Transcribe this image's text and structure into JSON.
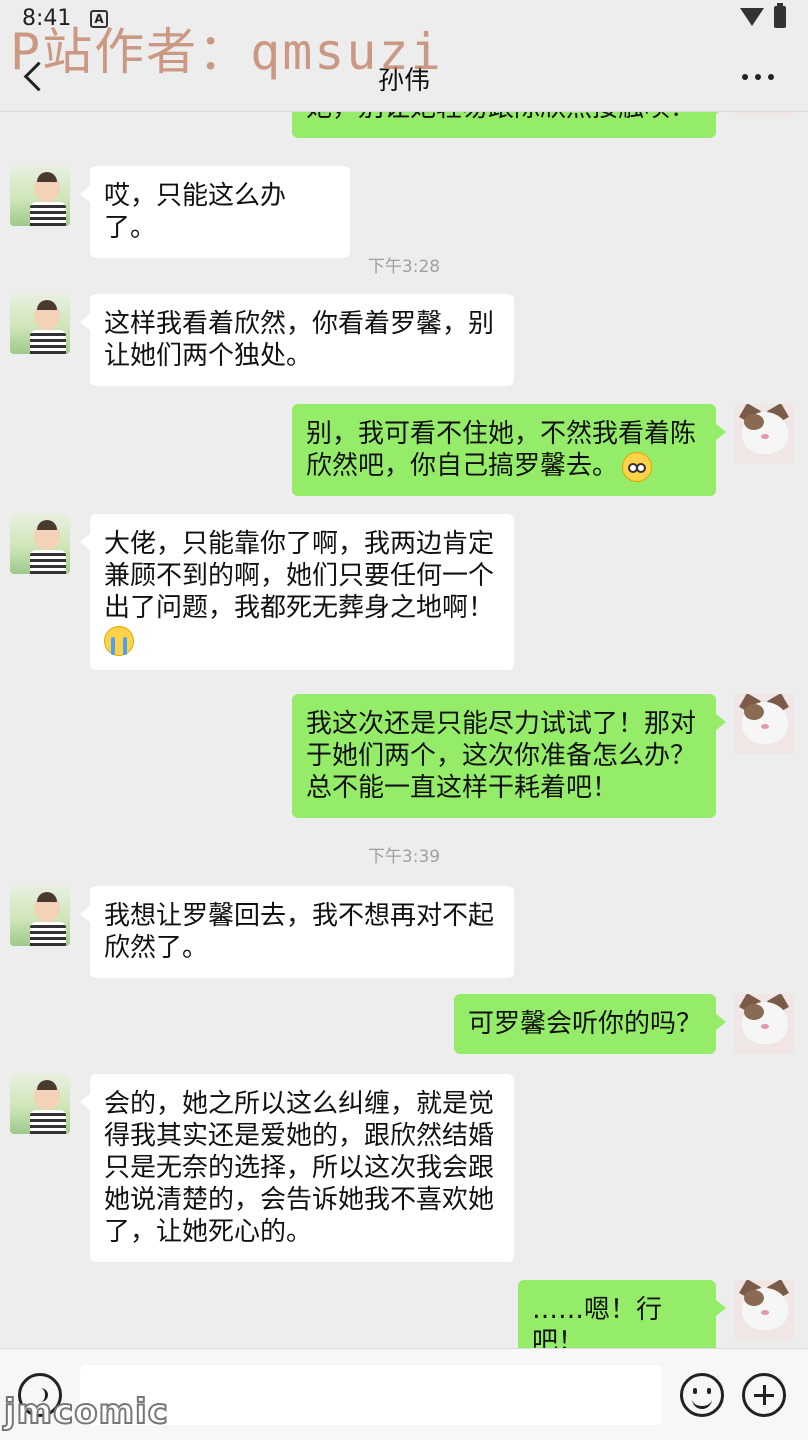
{
  "status_bar": {
    "time": "8:41",
    "notification_icon": "A"
  },
  "watermark": "P站作者：qmsuzi",
  "header": {
    "title": "孙伟"
  },
  "messages": [
    {
      "side": "out",
      "text": "她，别让她轻易跟陈欣然接触呗？"
    },
    {
      "side": "in",
      "text": "哎，只能这么办了。"
    },
    {
      "time": "下午3:28"
    },
    {
      "side": "in",
      "text": "这样我看着欣然，你看着罗馨，别\n让她们两个独处。"
    },
    {
      "side": "out",
      "text": "别，我可看不住她，不然我看着陈\n欣然吧，你自己搞罗馨去。",
      "emoji": "flushed-face-icon"
    },
    {
      "side": "in",
      "text": "大佬，只能靠你了啊，我两边肯定\n兼顾不到的啊，她们只要任何一个\n出了问题，我都死无葬身之地啊！",
      "emoji": "loudly-crying-face-icon"
    },
    {
      "side": "out",
      "text": "我这次还是只能尽力试试了！那对\n于她们两个，这次你准备怎么办？\n总不能一直这样干耗着吧！"
    },
    {
      "time": "下午3:39"
    },
    {
      "side": "in",
      "text": "我想让罗馨回去，我不想再对不起\n欣然了。"
    },
    {
      "side": "out",
      "text": "可罗馨会听你的吗？"
    },
    {
      "side": "in",
      "text": "会的，她之所以这么纠缠，就是觉\n得我其实还是爱她的，跟欣然结婚\n只是无奈的选择，所以这次我会跟\n她说清楚的，会告诉她我不喜欢她\n了，让她死心的。"
    },
    {
      "side": "out",
      "text": "……嗯！行吧！"
    }
  ],
  "input_bar": {
    "placeholder": ""
  },
  "logo_watermark": "jmcomic",
  "colors": {
    "background": "#ededed",
    "outgoing_bubble": "#95ec69",
    "incoming_bubble": "#ffffff",
    "timestamp": "#a0a0a0"
  }
}
